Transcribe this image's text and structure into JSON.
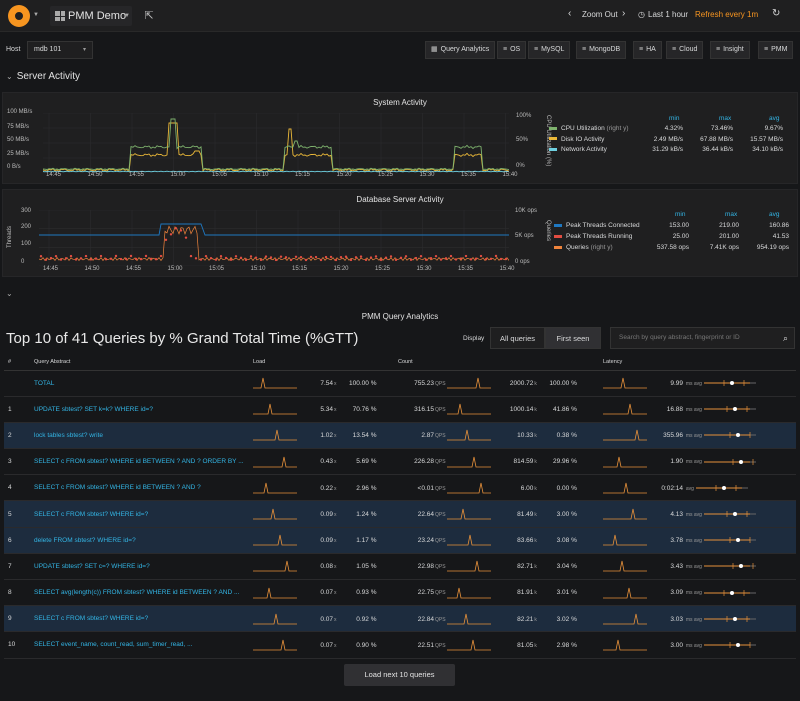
{
  "topbar": {
    "dashboard_title": "PMM Demo",
    "zoom_out": "Zoom Out",
    "time_range": "Last 1 hour",
    "refresh": "Refresh every 1m"
  },
  "host": {
    "label": "Host",
    "value": "mdb 101"
  },
  "nav_buttons": [
    "Query Analytics",
    "OS",
    "MySQL",
    "MongoDB",
    "HA",
    "Cloud",
    "Insight",
    "PMM"
  ],
  "server_activity_row": "Server Activity",
  "system_activity": {
    "title": "System Activity",
    "y_left_ticks": [
      "100 MB/s",
      "75 MB/s",
      "50 MB/s",
      "25 MB/s",
      "0 B/s"
    ],
    "y_right_ticks": [
      "100%",
      "50%",
      "0%"
    ],
    "y_right_label": "CPU Utilization (%)",
    "x_ticks": [
      "14:45",
      "14:50",
      "14:55",
      "15:00",
      "15:05",
      "15:10",
      "15:15",
      "15:20",
      "15:25",
      "15:30",
      "15:35",
      "15:40"
    ],
    "legend_headers": [
      "min",
      "max",
      "avg"
    ],
    "legend": [
      {
        "name": "CPU Utilization",
        "suffix": "(right y)",
        "color": "#7eb26d",
        "min": "4.32%",
        "max": "73.46%",
        "avg": "9.67%"
      },
      {
        "name": "Disk IO Activity",
        "suffix": "",
        "color": "#eab839",
        "min": "2.49 MB/s",
        "max": "67.88 MB/s",
        "avg": "15.57 MB/s"
      },
      {
        "name": "Network Activity",
        "suffix": "",
        "color": "#6ed0e0",
        "min": "31.29 kB/s",
        "max": "36.44 kB/s",
        "avg": "34.10 kB/s"
      }
    ]
  },
  "db_activity": {
    "title": "Database Server Activity",
    "y_left_label": "Threads",
    "y_left_ticks": [
      "300",
      "200",
      "100",
      "0"
    ],
    "y_right_ticks": [
      "10K ops",
      "5K ops",
      "0 ops"
    ],
    "y_right_label": "Queries",
    "x_ticks": [
      "14:45",
      "14:50",
      "14:55",
      "15:00",
      "15:05",
      "15:10",
      "15:15",
      "15:20",
      "15:25",
      "15:30",
      "15:35",
      "15:40"
    ],
    "legend_headers": [
      "min",
      "max",
      "avg"
    ],
    "legend": [
      {
        "name": "Peak Threads Connected",
        "suffix": "",
        "color": "#1f78c1",
        "min": "153.00",
        "max": "219.00",
        "avg": "160.86"
      },
      {
        "name": "Peak Threads Running",
        "suffix": "",
        "color": "#e24d42",
        "min": "25.00",
        "max": "201.00",
        "avg": "41.53"
      },
      {
        "name": "Queries",
        "suffix": "(right y)",
        "color": "#ef843c",
        "min": "537.58 ops",
        "max": "7.41K ops",
        "avg": "954.19 ops"
      }
    ]
  },
  "qan": {
    "panel_title": "PMM Query Analytics",
    "heading": "Top 10 of 41 Queries by % Grand Total Time (%GTT)",
    "display_label": "Display",
    "all_queries": "All queries",
    "first_seen": "First seen",
    "search_placeholder": "Search by query abstract, fingerprint or ID",
    "columns": [
      "#",
      "Query Abstract",
      "Load",
      "Count",
      "Latency"
    ],
    "rows": [
      {
        "n": "",
        "q": "TOTAL",
        "load": "7.54",
        "load_pct": "100.00 %",
        "qps": "755.23",
        "cnt": "2000.72",
        "cnt_pct": "100.00 %",
        "lat": "9.99",
        "lat_unit": "ms avg",
        "sel": false
      },
      {
        "n": "1",
        "q": "UPDATE sbtest? SET k=k? WHERE id=?",
        "load": "5.34",
        "load_pct": "70.76 %",
        "qps": "316.15",
        "cnt": "1000.14",
        "cnt_pct": "41.86 %",
        "lat": "16.88",
        "lat_unit": "ms avg",
        "sel": false
      },
      {
        "n": "2",
        "q": "lock tables sbtest? write",
        "load": "1.02",
        "load_pct": "13.54 %",
        "qps": "2.87",
        "cnt": "10.33",
        "cnt_pct": "0.38 %",
        "lat": "355.96",
        "lat_unit": "ms avg",
        "sel": true
      },
      {
        "n": "3",
        "q": "SELECT c FROM sbtest? WHERE id BETWEEN ? AND ? ORDER BY ...",
        "load": "0.43",
        "load_pct": "5.69 %",
        "qps": "226.28",
        "cnt": "814.59",
        "cnt_pct": "29.96 %",
        "lat": "1.90",
        "lat_unit": "ms avg",
        "sel": false
      },
      {
        "n": "4",
        "q": "SELECT c FROM sbtest? WHERE id BETWEEN ? AND ?",
        "load": "0.22",
        "load_pct": "2.96 %",
        "qps": "<0.01",
        "cnt": "6.00",
        "cnt_pct": "0.00 %",
        "lat": "0:02:14",
        "lat_unit": "avg",
        "sel": false
      },
      {
        "n": "5",
        "q": "SELECT c FROM sbtest? WHERE id=?",
        "load": "0.09",
        "load_pct": "1.24 %",
        "qps": "22.64",
        "cnt": "81.49",
        "cnt_pct": "3.00 %",
        "lat": "4.13",
        "lat_unit": "ms avg",
        "sel": true
      },
      {
        "n": "6",
        "q": "delete FROM sbtest? WHERE id=?",
        "load": "0.09",
        "load_pct": "1.17 %",
        "qps": "23.24",
        "cnt": "83.66",
        "cnt_pct": "3.08 %",
        "lat": "3.78",
        "lat_unit": "ms avg",
        "sel": true
      },
      {
        "n": "7",
        "q": "UPDATE sbtest? SET c=? WHERE id=?",
        "load": "0.08",
        "load_pct": "1.05 %",
        "qps": "22.98",
        "cnt": "82.71",
        "cnt_pct": "3.04 %",
        "lat": "3.43",
        "lat_unit": "ms avg",
        "sel": false
      },
      {
        "n": "8",
        "q": "SELECT avg(length(c)) FROM sbtest? WHERE id BETWEEN ? AND ...",
        "load": "0.07",
        "load_pct": "0.93 %",
        "qps": "22.75",
        "cnt": "81.91",
        "cnt_pct": "3.01 %",
        "lat": "3.09",
        "lat_unit": "ms avg",
        "sel": false
      },
      {
        "n": "9",
        "q": "SELECT c FROM sbtest? WHERE id=?",
        "load": "0.07",
        "load_pct": "0.92 %",
        "qps": "22.84",
        "cnt": "82.21",
        "cnt_pct": "3.02 %",
        "lat": "3.03",
        "lat_unit": "ms avg",
        "sel": true
      },
      {
        "n": "10",
        "q": "SELECT event_name, count_read, sum_timer_read, ...",
        "load": "0.07",
        "load_pct": "0.90 %",
        "qps": "22.51",
        "cnt": "81.05",
        "cnt_pct": "2.98 %",
        "lat": "3.00",
        "lat_unit": "ms avg",
        "sel": false
      }
    ],
    "load_unit": "x",
    "qps_unit": "QPS",
    "cnt_unit": "k",
    "load_more": "Load next 10 queries"
  },
  "colors": {
    "accent": "#33b5e5",
    "orange": "#f79520",
    "spark": "#e5903a"
  }
}
